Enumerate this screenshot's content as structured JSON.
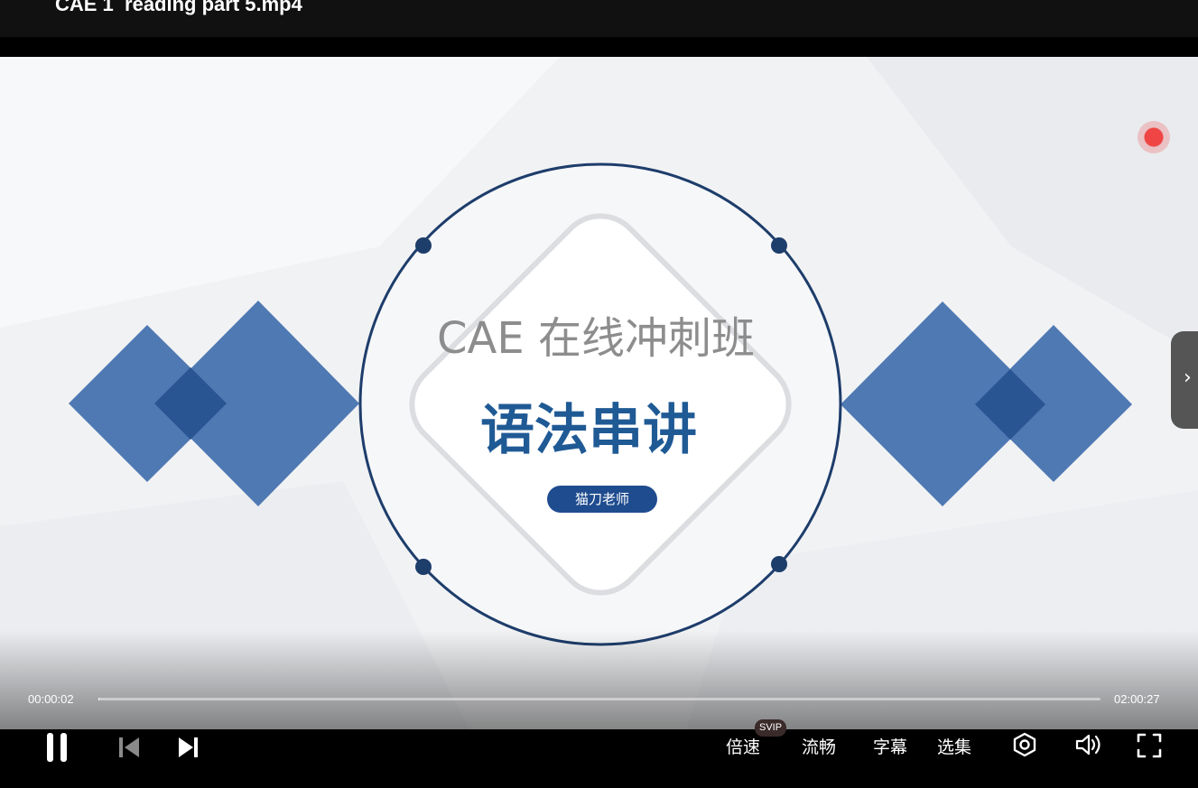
{
  "window": {
    "title": "CAE 1  reading part 5.mp4"
  },
  "slide": {
    "heading": "CAE 在线冲刺班",
    "subtitle": "语法串讲",
    "teacher": "猫刀老师"
  },
  "player": {
    "current_time": "00:00:02",
    "total_time": "02:00:27",
    "progress_fraction": 0.0003,
    "side_tab_icon": "chevron-right-icon",
    "controls": {
      "speed_label": "倍速",
      "speed_badge": "SVIP",
      "quality_label": "流畅",
      "subtitles_label": "字幕",
      "episodes_label": "选集"
    }
  },
  "colors": {
    "accent_blue": "#2f5f9e",
    "diamond_blue": "#4f79b3",
    "circle_navy": "#1d3d6b",
    "record_red": "#ef4545"
  }
}
